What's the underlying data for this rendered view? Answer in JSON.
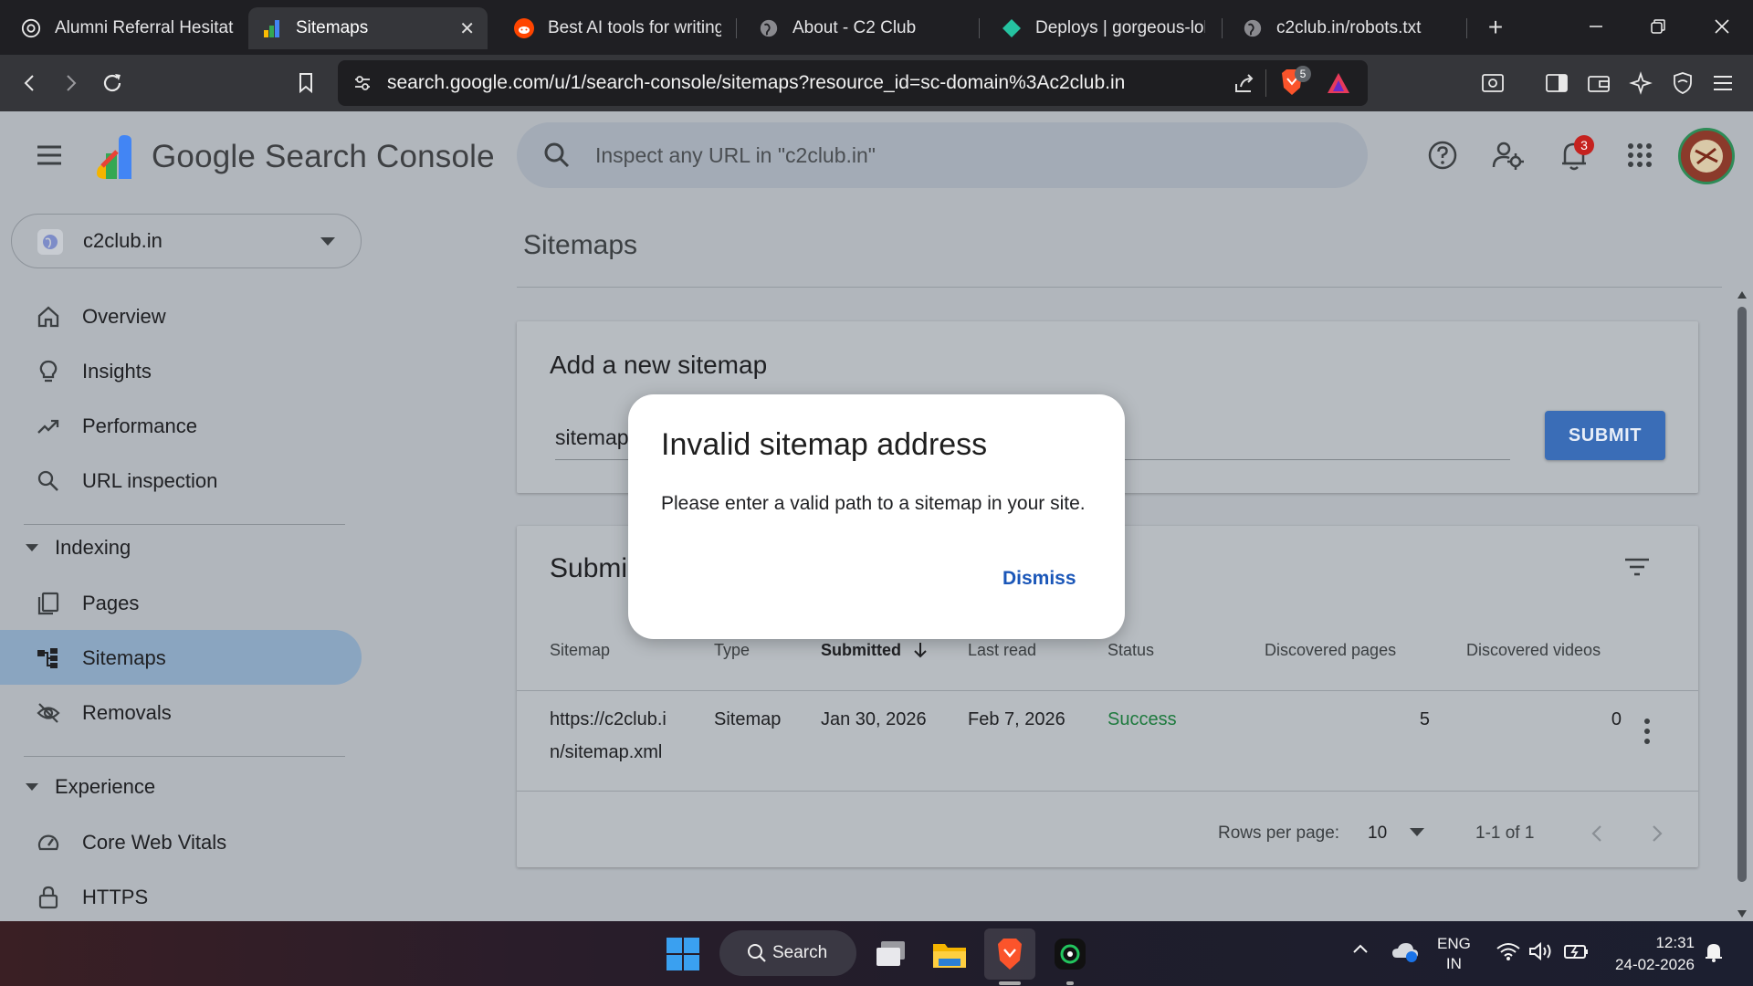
{
  "browser": {
    "tabs": [
      {
        "title": "Alumni Referral Hesitatio",
        "icon": "openai-icon"
      },
      {
        "title": "Sitemaps",
        "icon": "search-console-icon",
        "active": true,
        "close": "✕"
      },
      {
        "title": "Best AI tools for writing",
        "icon": "reddit-icon"
      },
      {
        "title": "About - C2 Club",
        "icon": "globe-icon"
      },
      {
        "title": "Deploys | gorgeous-lolly",
        "icon": "netlify-icon"
      },
      {
        "title": "c2club.in/robots.txt",
        "icon": "globe-icon"
      }
    ],
    "new_tab": "+",
    "url": "search.google.com/u/1/search-console/sitemaps?resource_id=sc-domain%3Ac2club.in",
    "brave_badge": "5"
  },
  "app": {
    "brand": "Google Search Console",
    "search_placeholder": "Inspect any URL in \"c2club.in\"",
    "notification_count": "3",
    "property": "c2club.in",
    "nav": {
      "overview": "Overview",
      "insights": "Insights",
      "performance": "Performance",
      "url_inspection": "URL inspection",
      "indexing_section": "Indexing",
      "pages": "Pages",
      "sitemaps": "Sitemaps",
      "removals": "Removals",
      "experience_section": "Experience",
      "core_web_vitals": "Core Web Vitals",
      "https": "HTTPS"
    },
    "page_title": "Sitemaps",
    "add_card": {
      "title": "Add a new sitemap",
      "input_value": "sitemap",
      "submit": "SUBMIT"
    },
    "submitted_card": {
      "title": "Submi",
      "headers": {
        "sitemap": "Sitemap",
        "type": "Type",
        "submitted": "Submitted",
        "last_read": "Last read",
        "status": "Status",
        "discovered_pages": "Discovered pages",
        "discovered_videos": "Discovered videos"
      },
      "rows": [
        {
          "sitemap_line1": "https://c2club.i",
          "sitemap_line2": "n/sitemap.xml",
          "type": "Sitemap",
          "submitted": "Jan 30, 2026",
          "last_read": "Feb 7, 2026",
          "status": "Success",
          "discovered_pages": "5",
          "discovered_videos": "0"
        }
      ],
      "rows_per_page_label": "Rows per page:",
      "rows_per_page_value": "10",
      "pagination": "1-1 of 1",
      "colors": {
        "status_success": "#1e7a3e",
        "submit_button": "#3a6db7"
      }
    }
  },
  "dialog": {
    "title": "Invalid sitemap address",
    "body": "Please enter a valid path to a sitemap in your site.",
    "dismiss": "Dismiss"
  },
  "taskbar": {
    "search": "Search",
    "lang_line1": "ENG",
    "lang_line2": "IN",
    "time": "12:31",
    "date": "24-02-2026"
  }
}
